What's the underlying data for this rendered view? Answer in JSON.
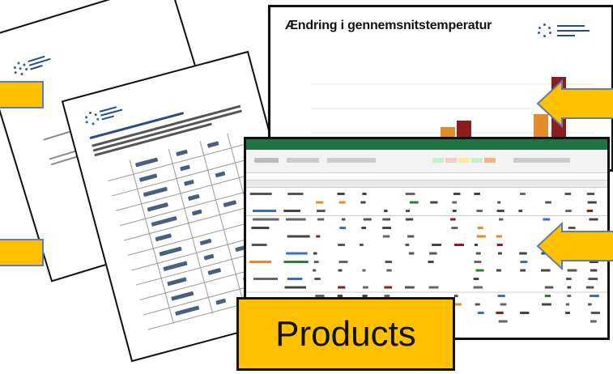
{
  "chart_page": {
    "title": "Ændring i gennemsnitstemperatur"
  },
  "label": {
    "text": "Products"
  },
  "colors": {
    "arrow_fill": "#ffc000",
    "arrow_stroke": "#5b7cc0",
    "label_fill": "#ffc000",
    "excel_green": "#217346",
    "bar_orange": "#e38c2c",
    "bar_darkred": "#8e1d1d"
  },
  "icons": {
    "arrow": "block-arrow",
    "logo": "dotted-circle-logo"
  }
}
